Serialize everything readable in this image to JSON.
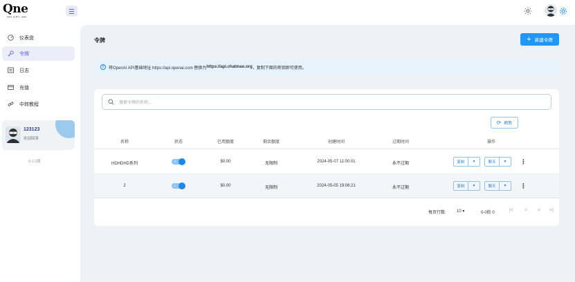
{
  "app": {
    "logo_text": "Qne",
    "logo_sub": "API",
    "version": "0.0.2版"
  },
  "header": {
    "menu_icon": "menu-icon",
    "theme_icon": "sun-icon",
    "settings_icon": "gear-icon"
  },
  "sidebar": {
    "items": [
      {
        "label": "仪表盘",
        "icon": "dashboard-icon",
        "active": false
      },
      {
        "label": "令牌",
        "icon": "key-icon",
        "active": true
      },
      {
        "label": "日志",
        "icon": "log-icon",
        "active": false
      },
      {
        "label": "充值",
        "icon": "wallet-icon",
        "active": false
      },
      {
        "label": "中转教程",
        "icon": "link-icon",
        "active": false
      }
    ],
    "user": {
      "name": "123123",
      "subtitle": "欢迎回来"
    }
  },
  "main": {
    "title": "令牌",
    "new_button": "新建令牌",
    "alert": {
      "prefix": "将OpenAI API基础地址 https://api.openai.com 替换为 ",
      "highlight": "https://api.chatmao.org",
      "suffix": "，复制下面的密钥即可使用。"
    },
    "search_placeholder": "搜索令牌的名称...",
    "refresh_button": "刷新",
    "columns": [
      "名称",
      "状态",
      "已用额度",
      "剩余额度",
      "创建时间",
      "过期时间",
      "操作"
    ],
    "rows": [
      {
        "name": "HDHDHD系列",
        "enabled": true,
        "used": "$0.00",
        "remaining": "无限制",
        "created": "2024-05-07 11:00:01",
        "expires": "永不过期",
        "copy": "复制",
        "chat": "聊天"
      },
      {
        "name": "2",
        "enabled": true,
        "used": "$0.00",
        "remaining": "无限制",
        "created": "2024-05-05 19:06:21",
        "expires": "永不过期",
        "copy": "复制",
        "chat": "聊天"
      }
    ],
    "pagination": {
      "rows_per_page_label": "每页行数:",
      "rows_per_page": "10",
      "range": "0-0的 0"
    }
  },
  "colors": {
    "accent": "#2196f3",
    "active_nav": "#5b5fcf",
    "main_bg": "#eef1f6"
  }
}
